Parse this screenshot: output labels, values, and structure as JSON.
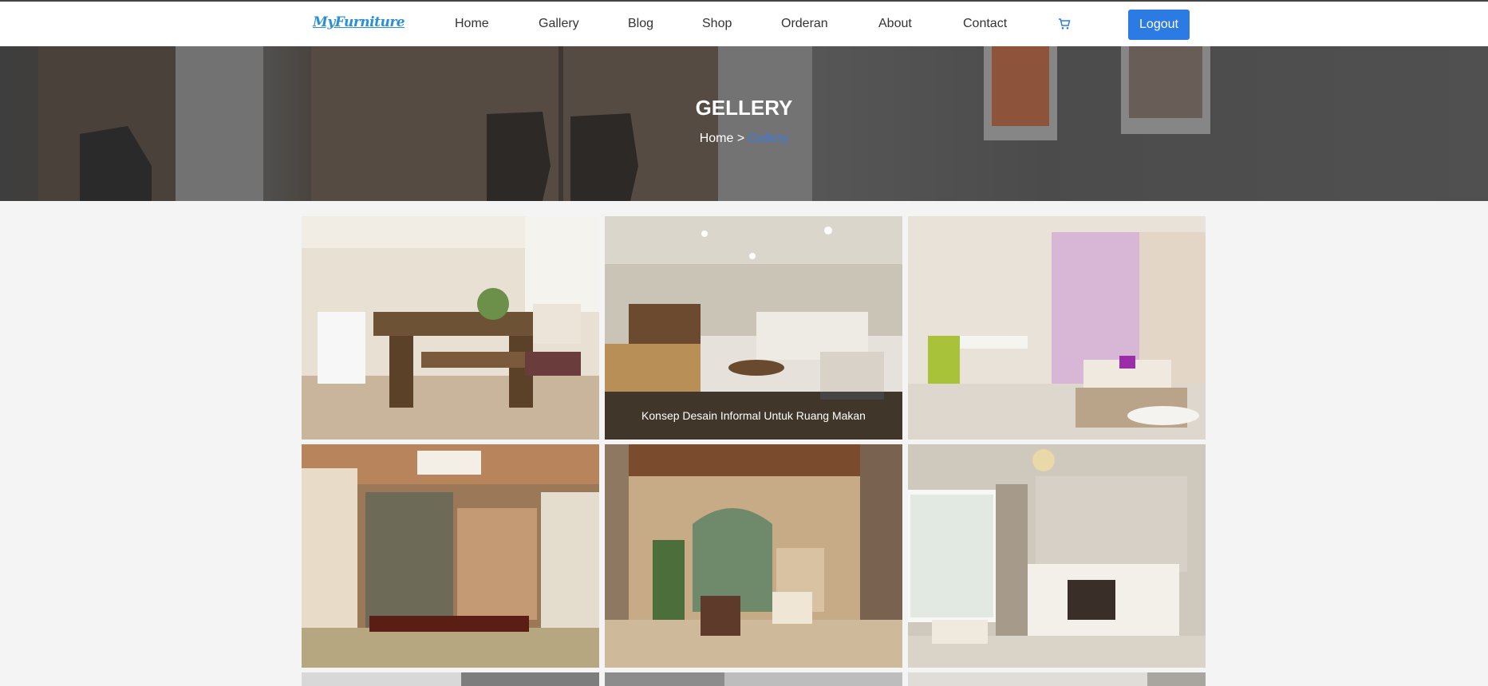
{
  "header": {
    "logo": "MyFurniture",
    "nav": [
      "Home",
      "Gallery",
      "Blog",
      "Shop",
      "Orderan",
      "About",
      "Contact"
    ],
    "cart_icon": "cart-icon",
    "logout_label": "Logout"
  },
  "hero": {
    "title": "GELLERY",
    "breadcrumb_home": "Home",
    "breadcrumb_sep": ">",
    "breadcrumb_current": "Gallery"
  },
  "gallery": {
    "tiles": [
      {
        "caption": ""
      },
      {
        "caption": "Konsep Desain Informal Untuk Ruang Makan"
      },
      {
        "caption": ""
      },
      {
        "caption": ""
      },
      {
        "caption": ""
      },
      {
        "caption": ""
      }
    ]
  },
  "colors": {
    "accent": "#2c7be5",
    "logo": "#2b8fd6",
    "breadcrumb_active": "#3b7be0"
  }
}
